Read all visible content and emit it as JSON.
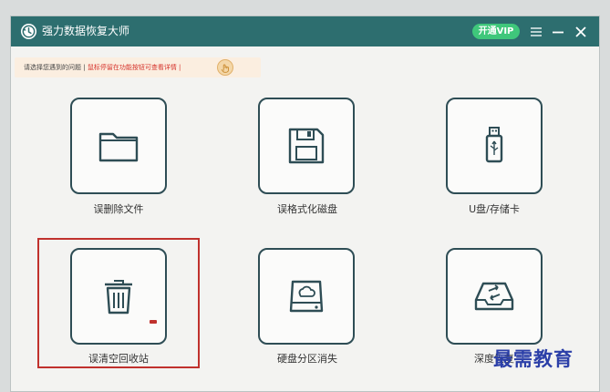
{
  "app": {
    "title": "强力数据恢复大师",
    "vip_label": "开通VIP"
  },
  "hint": {
    "question": "请选择您遇到的问题 |",
    "tip": "鼠标停留在功能按钮可查看详情 |"
  },
  "options": [
    {
      "label": "误删除文件",
      "icon": "folder-icon"
    },
    {
      "label": "误格式化磁盘",
      "icon": "floppy-disk-icon"
    },
    {
      "label": "U盘/存储卡",
      "icon": "usb-drive-icon"
    },
    {
      "label": "误清空回收站",
      "icon": "trash-bin-icon"
    },
    {
      "label": "硬盘分区消失",
      "icon": "hard-disk-icon"
    },
    {
      "label": "深度恢复",
      "icon": "deep-scan-icon"
    }
  ],
  "watermark": "最需教育",
  "colors": {
    "titlebar": "#2d6e6f",
    "vip": "#3fc77b",
    "tile_border": "#2e4d55",
    "highlight": "#c0312d",
    "hint_bg": "#fbeee0",
    "hint_red": "#d6342c",
    "watermark": "#2b3fa8"
  }
}
